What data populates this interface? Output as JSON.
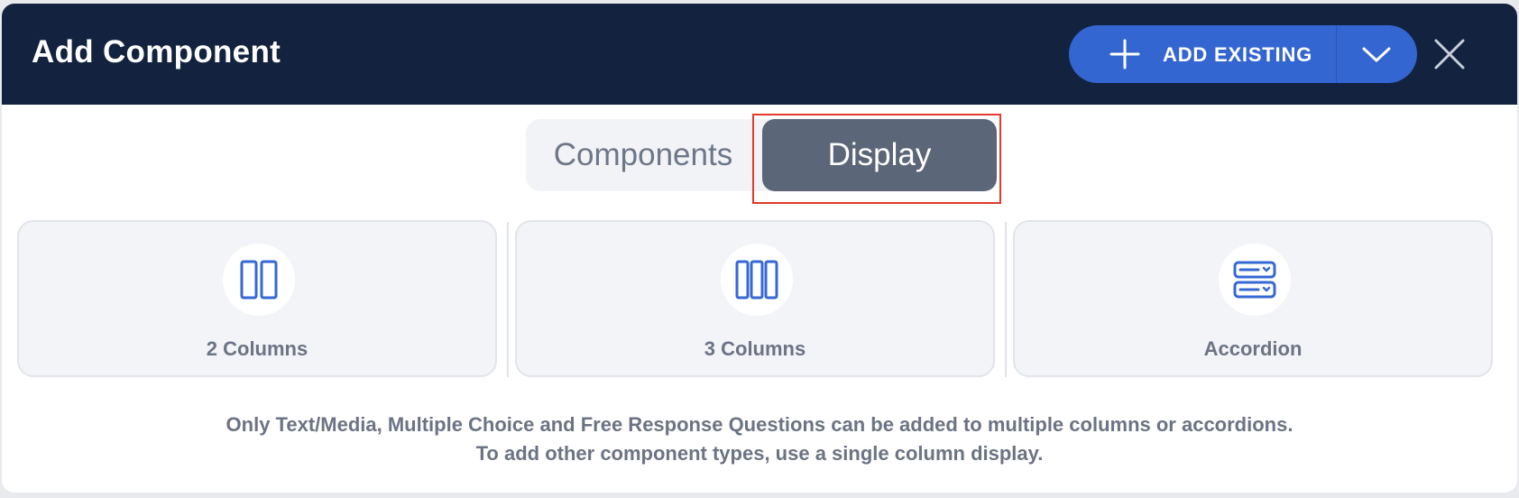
{
  "header": {
    "title": "Add Component",
    "add_existing_label": "ADD EXISTING",
    "add_existing_icon": "plus-icon",
    "dropdown_icon": "chevron-down-icon",
    "close_icon": "close-icon",
    "background_color": "#13233f",
    "button_color": "#3466d2"
  },
  "tabs": [
    {
      "label": "Components",
      "active": false
    },
    {
      "label": "Display",
      "active": true
    }
  ],
  "cards": [
    {
      "label": "2 Columns",
      "icon": "two-columns-icon"
    },
    {
      "label": "3 Columns",
      "icon": "three-columns-icon"
    },
    {
      "label": "Accordion",
      "icon": "accordion-icon"
    }
  ],
  "info": {
    "line1": "Only Text/Media, Multiple Choice and Free Response Questions can be added to multiple columns or accordions.",
    "line2": "To add other component types, use a single column display."
  },
  "colors": {
    "accent": "#3466d2",
    "active_tab": "#5b6678",
    "highlight": "#e03b2b",
    "icon_blue": "#3568d4"
  }
}
